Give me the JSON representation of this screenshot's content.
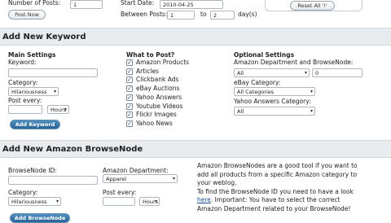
{
  "top": {
    "posts_label": "Number of Posts:",
    "posts_value": "1",
    "post_now": "Post Now",
    "start_label": "Start Date:",
    "start_value": "2010-04-25",
    "between_label": "Between Posts:",
    "between_from": "1",
    "between_to_label": "to",
    "between_to": "2",
    "days_label": "day(s)",
    "reset_label": "Reset All '!'"
  },
  "keyword": {
    "section_title": "Add New Keyword",
    "main_title": "Main Settings",
    "keyword_label": "Keyword:",
    "keyword_value": "",
    "category_label": "Category:",
    "category_value": "Hilariousness",
    "post_every_label": "Post every:",
    "post_every_value": "",
    "hours_value": "Hours",
    "add_button": "Add Keyword",
    "what_title": "What to Post?",
    "options": [
      {
        "label": "Amazon Products",
        "checked": true
      },
      {
        "label": "Articles",
        "checked": true
      },
      {
        "label": "Clickbank Ads",
        "checked": true
      },
      {
        "label": "eBay Auctions",
        "checked": true
      },
      {
        "label": "Yahoo Answers",
        "checked": true
      },
      {
        "label": "Youtube Videos",
        "checked": true
      },
      {
        "label": "Flickr Images",
        "checked": true
      },
      {
        "label": "Yahoo News",
        "checked": true
      }
    ],
    "optional_title": "Optional Settings",
    "amazon_dept_label": "Amazon Department and BrowseNode:",
    "amazon_dept_value": "All",
    "browsenode_value": "0",
    "ebay_cat_label": "eBay Category:",
    "ebay_cat_value": "All Categories",
    "yahoo_cat_label": "Yahoo Answers Category:",
    "yahoo_cat_value": "All"
  },
  "browsenode": {
    "section_title": "Add New Amazon BrowseNode",
    "id_label": "BrowseNode ID:",
    "id_value": "",
    "dept_label": "Amazon Department:",
    "dept_value": "Apparel",
    "category_label": "Category:",
    "category_value": "Hilariousness",
    "post_every_label": "Post every:",
    "post_every_value": "",
    "hours_value": "Hours",
    "add_button": "Add BrowseNode",
    "info_1": "Amazon BrowseNodes are a good tool if you want to",
    "info_2": "add all products from a specific Amazon category to",
    "info_3": "your weblog.",
    "info_4": "To find the BrowseNode ID you need to have a look",
    "info_5_link": "here",
    "info_5_rest": ". Important: You have to select the correct",
    "info_6": "Amazon Department related to your BrowseNode!"
  }
}
